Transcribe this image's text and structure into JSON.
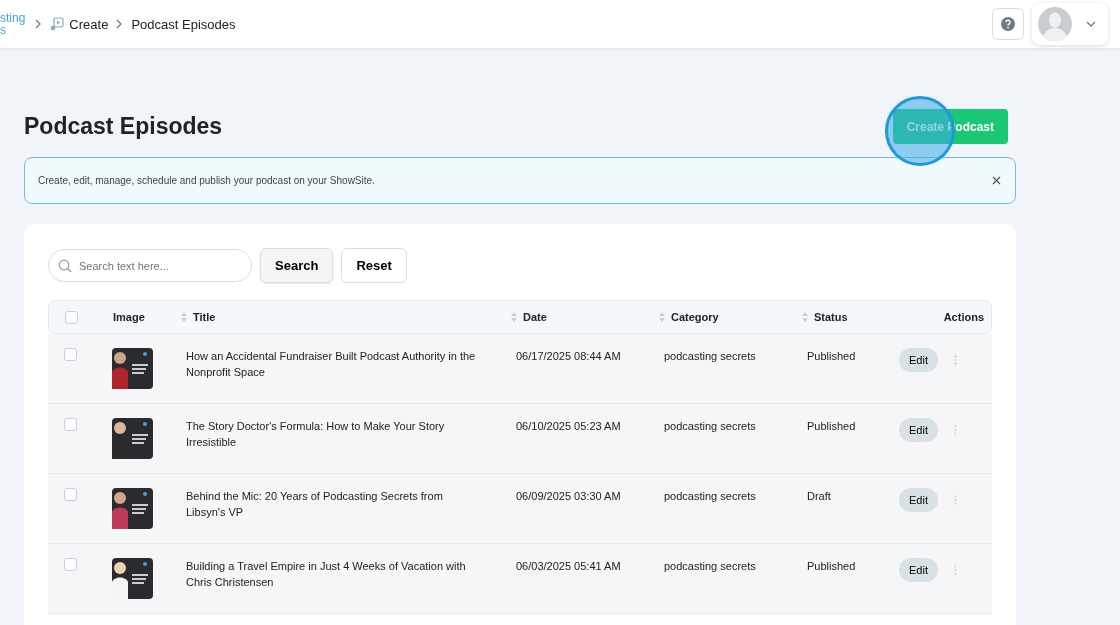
{
  "header": {
    "logo_lines": [
      "sting",
      "s"
    ],
    "breadcrumbs": [
      {
        "label": "Create",
        "icon": true
      },
      {
        "label": "Podcast Episodes",
        "icon": false
      }
    ]
  },
  "page": {
    "title": "Podcast Episodes",
    "create_button": "Create Podcast",
    "click_marker": true
  },
  "notice": {
    "text": "Create, edit, manage, schedule and publish your podcast on your ShowSite."
  },
  "search": {
    "placeholder": "Search text here...",
    "buttons": [
      {
        "label": "Search",
        "kind": "primary"
      },
      {
        "label": "Reset",
        "kind": "plain"
      }
    ]
  },
  "table": {
    "all_checked": false,
    "columns": [
      {
        "label": "Image",
        "sortable": false
      },
      {
        "label": "Title",
        "sortable": true
      },
      {
        "label": "Date",
        "sortable": true
      },
      {
        "label": "Category",
        "sortable": true
      },
      {
        "label": "Status",
        "sortable": true
      },
      {
        "label": "Actions",
        "sortable": false
      }
    ],
    "rows": [
      {
        "checked": false,
        "title": "How an Accidental Fundraiser Built Podcast Authority in the Nonprofit Space",
        "date": "06/17/2025 08:44 AM",
        "category": "podcasting secrets",
        "status": "Published",
        "action": "Edit"
      },
      {
        "checked": false,
        "title": "The Story Doctor's Formula: How to Make Your Story Irresistible",
        "date": "06/10/2025 05:23 AM",
        "category": "podcasting secrets",
        "status": "Published",
        "action": "Edit"
      },
      {
        "checked": false,
        "title": "Behind the Mic: 20 Years of Podcasting Secrets from Libsyn's VP",
        "date": "06/09/2025 03:30 AM",
        "category": "podcasting secrets",
        "status": "Draft",
        "action": "Edit"
      },
      {
        "checked": false,
        "title": "Building a Travel Empire in Just 4 Weeks of Vacation with Chris Christensen",
        "date": "06/03/2025 05:41 AM",
        "category": "podcasting secrets",
        "status": "Published",
        "action": "Edit"
      }
    ]
  }
}
